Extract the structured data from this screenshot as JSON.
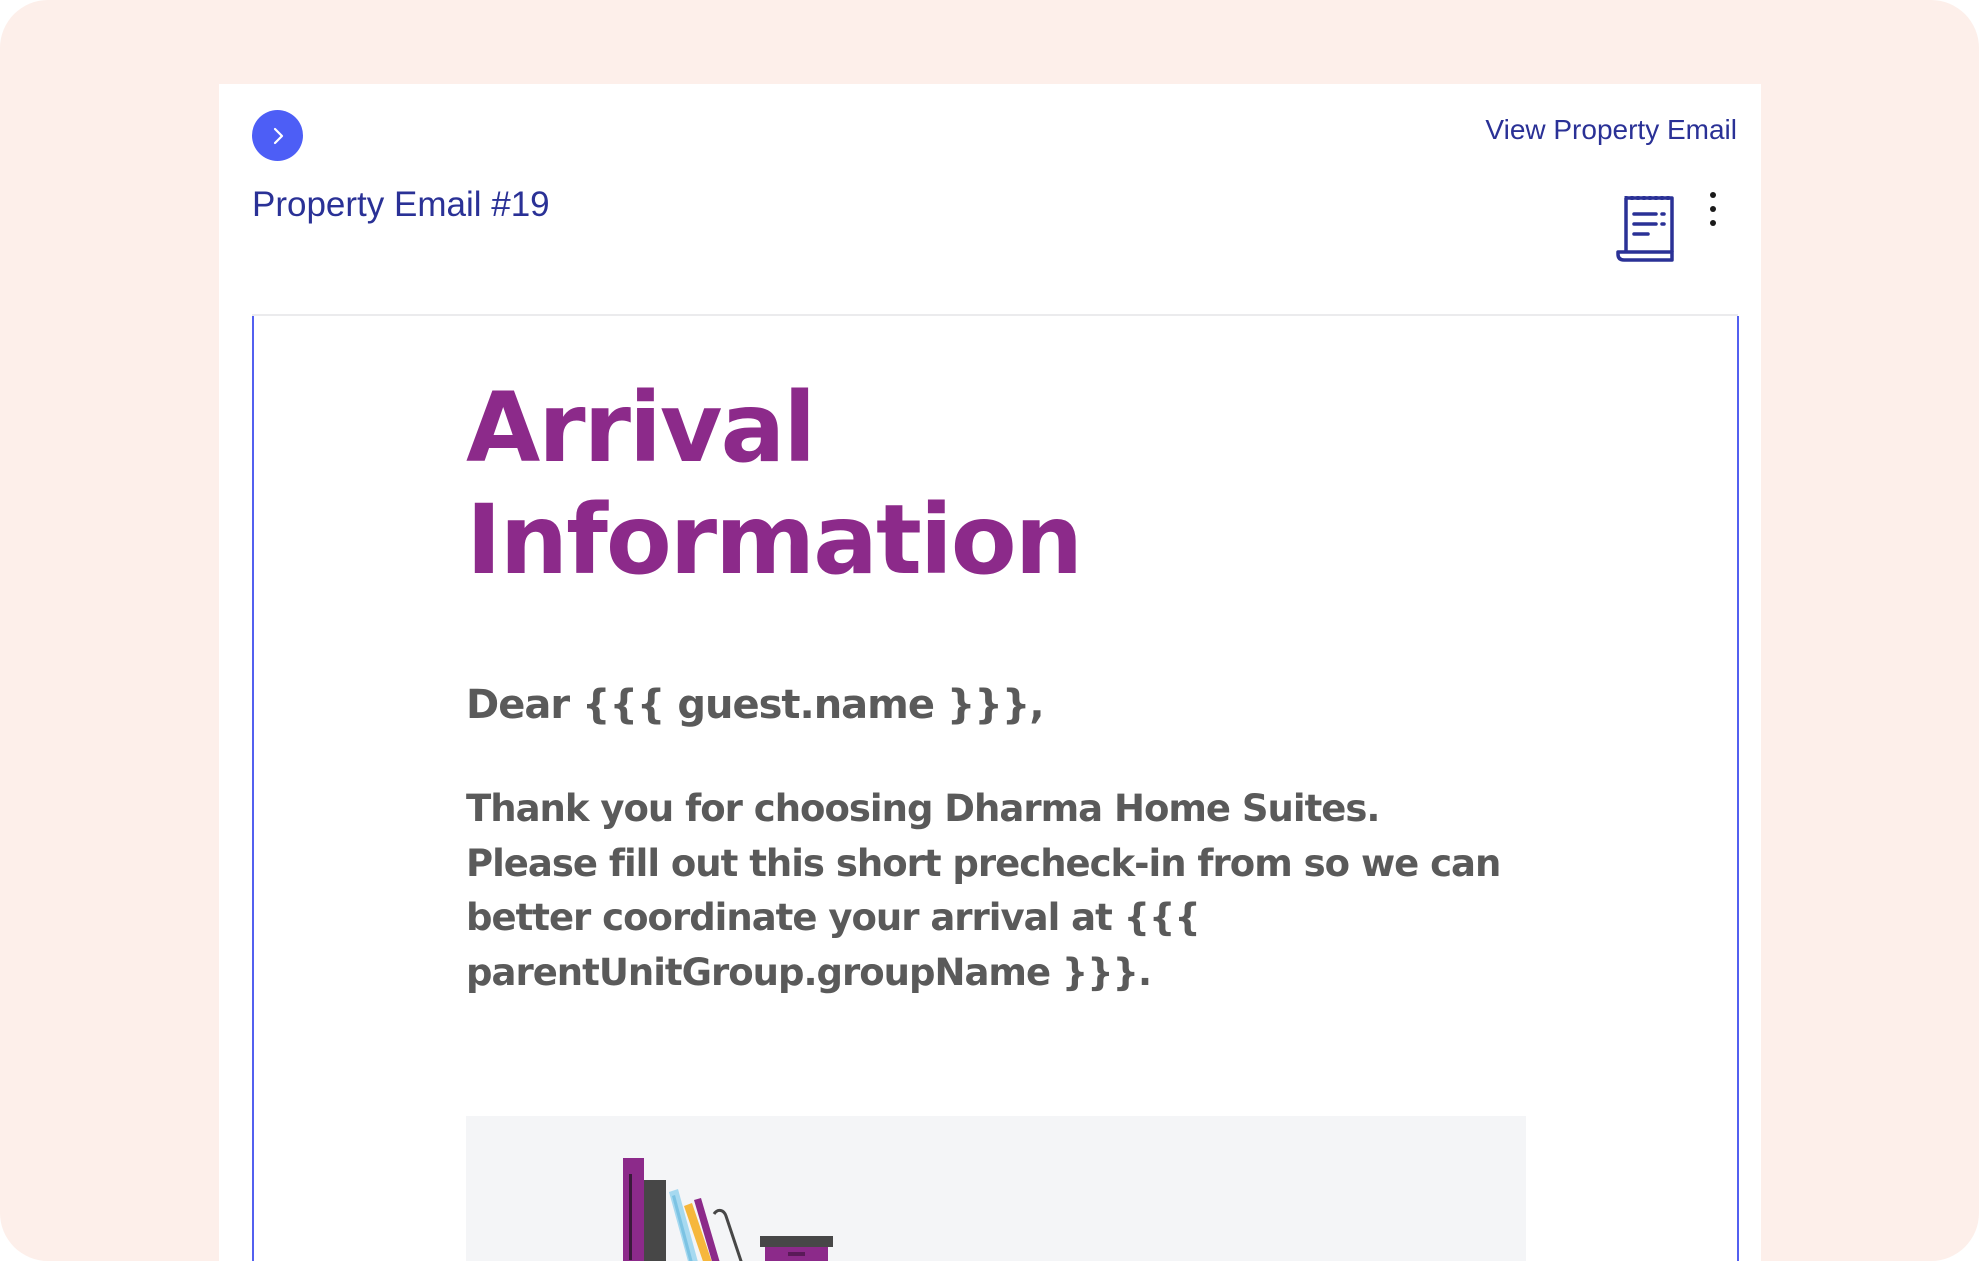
{
  "header": {
    "view_link_label": "View Property Email",
    "page_title": "Property Email #19",
    "nav_button_icon": "chevron-right-icon",
    "receipt_icon": "receipt-icon",
    "more_icon": "more-vertical-icon"
  },
  "email": {
    "heading_line1": "Arrival",
    "heading_line2": "Information",
    "greeting": "Dear {{{ guest.name }}},",
    "body": "Thank you for choosing Dharma Home Suites. Please fill out this short precheck-in from so we can better coordinate your arrival at {{{ parentUnitGroup.groupName }}}.",
    "illustration": "bookshelf-illustration"
  },
  "colors": {
    "accent": "#4d5ef6",
    "link": "#2a3196",
    "heading": "#8c2a8a",
    "body_text": "#5a5a5a",
    "background": "#fdefea"
  }
}
